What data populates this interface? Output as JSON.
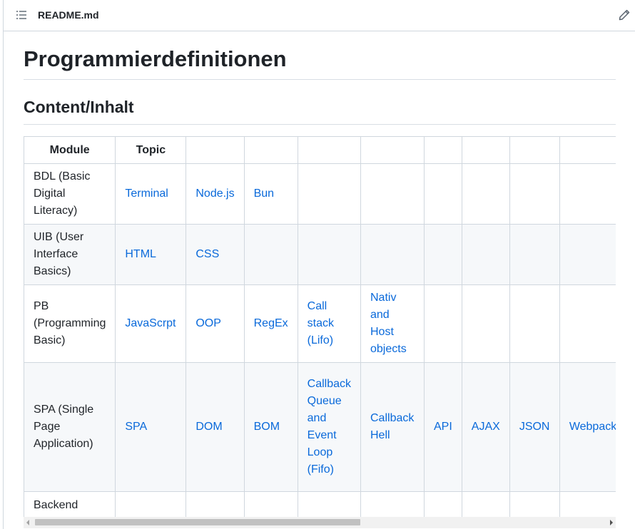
{
  "file_header": {
    "file_name": "README.md",
    "toc_icon": "list-unordered-icon",
    "edit_icon": "pencil-icon"
  },
  "document": {
    "h1": "Programmierdefinitionen",
    "h2": "Content/Inhalt"
  },
  "table": {
    "headers": [
      "Module",
      "Topic",
      "",
      "",
      "",
      "",
      "",
      "",
      "",
      ""
    ],
    "rows": [
      {
        "module": "BDL (Basic Digital Literacy)",
        "cells": [
          "Terminal",
          "Node.js",
          "Bun",
          "",
          "",
          "",
          "",
          "",
          ""
        ]
      },
      {
        "module": "UIB (User Interface Basics)",
        "cells": [
          "HTML",
          "CSS",
          "",
          "",
          "",
          "",
          "",
          "",
          ""
        ]
      },
      {
        "module": "PB (Programming Basic)",
        "cells": [
          "JavaScrpt",
          "OOP",
          "RegEx",
          "Call stack (Lifo)",
          "Nativ and Host objects",
          "",
          "",
          "",
          ""
        ]
      },
      {
        "module": "SPA (Single Page Application)",
        "cells": [
          "SPA",
          "DOM",
          "BOM",
          "Callback Queue and Event Loop (Fifo)",
          "Callback Hell",
          "API",
          "AJAX",
          "JSON",
          "Webpack"
        ]
      },
      {
        "module": "Backend",
        "cells": [
          "",
          "",
          "",
          "",
          "",
          "",
          "",
          "",
          ""
        ]
      }
    ]
  },
  "colors": {
    "link": "#0969da",
    "border": "#d0d7de",
    "shade": "#f6f8fa",
    "text": "#1f2328"
  }
}
